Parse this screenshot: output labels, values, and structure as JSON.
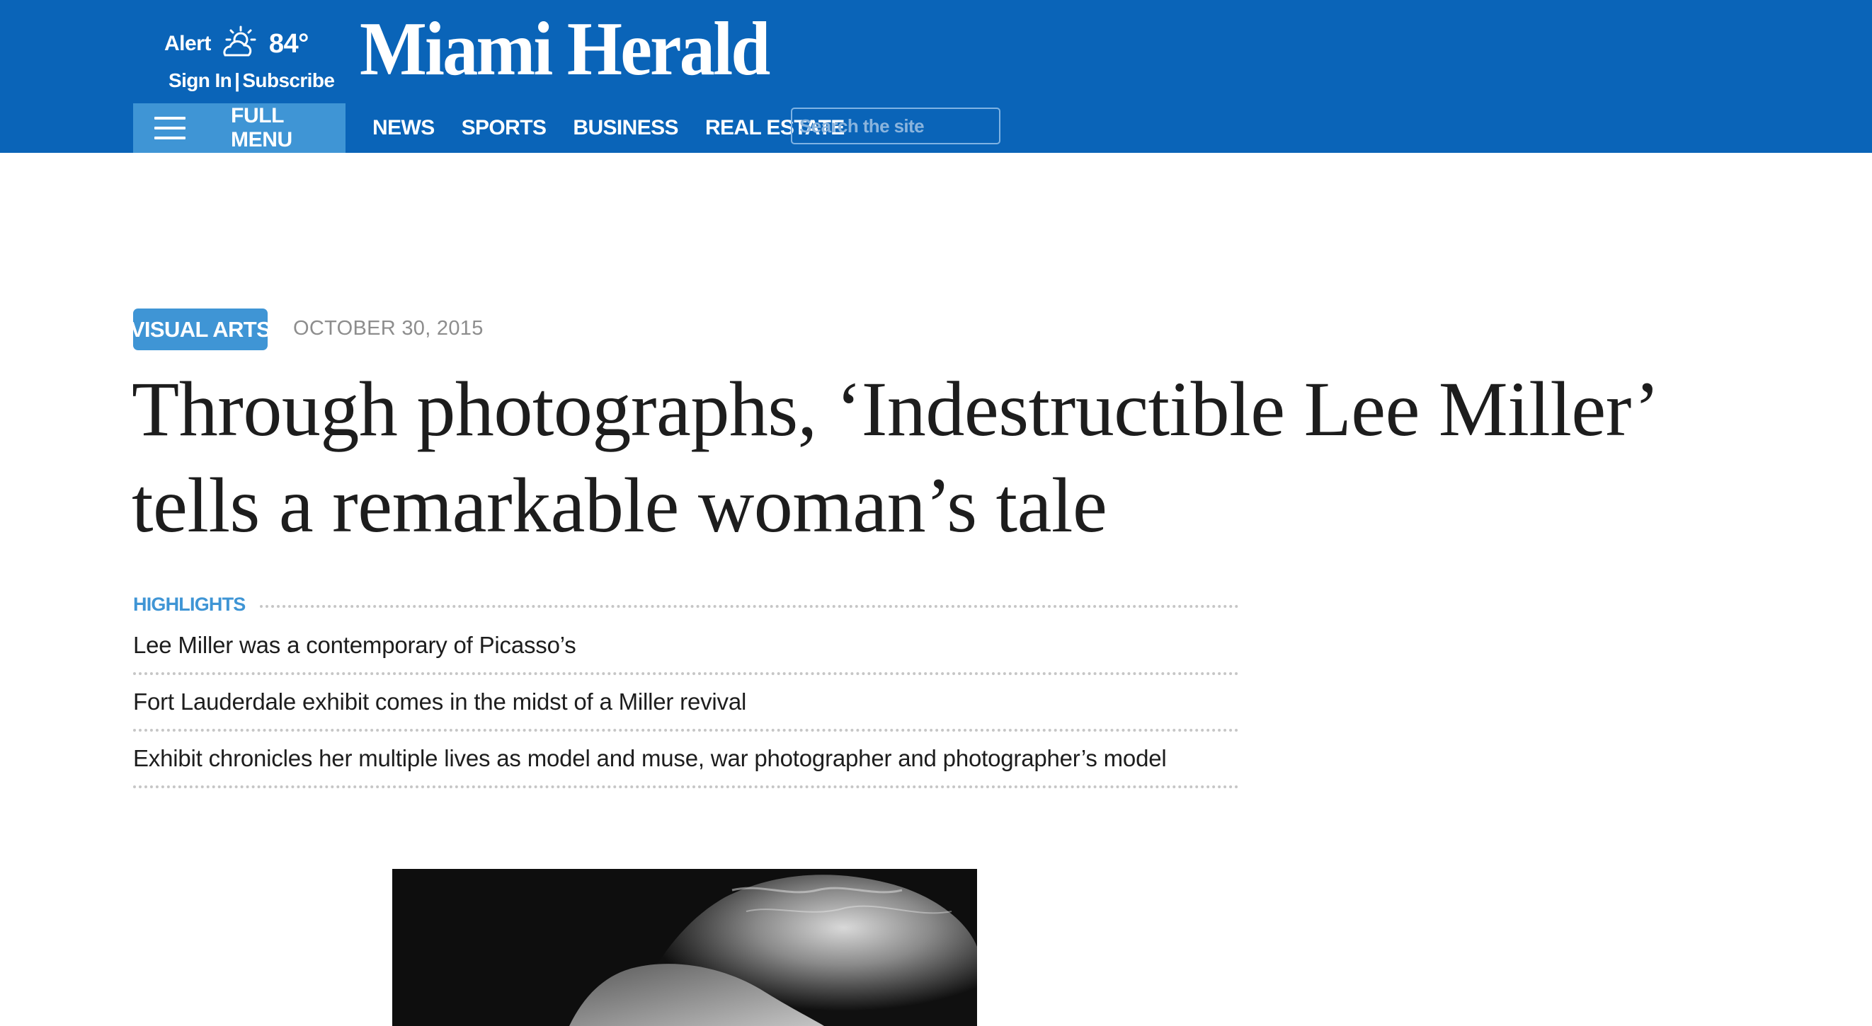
{
  "header": {
    "weather": {
      "alert_label": "Alert",
      "temperature": "84°",
      "icon": "partly-cloudy-icon"
    },
    "account": {
      "sign_in": "Sign In",
      "separator": "|",
      "subscribe": "Subscribe"
    },
    "logo_text": "Miami Herald",
    "menu_label": "FULL MENU",
    "nav": [
      "NEWS",
      "SPORTS",
      "BUSINESS",
      "REAL ESTATE"
    ],
    "search": {
      "placeholder": "Search the site",
      "value": ""
    }
  },
  "article": {
    "section_tag": "VISUAL ARTS",
    "date": "OCTOBER 30, 2015",
    "headline": "Through photographs, ‘Indestructible Lee Miller’ tells a remarkable woman’s tale",
    "highlights": {
      "title": "HIGHLIGHTS",
      "items": [
        "Lee Miller was a contemporary of Picasso’s",
        "Fort Lauderdale exhibit comes in the midst of a Miller revival",
        "Exhibit chronicles her multiple lives as model and muse, war photographer and photographer’s model"
      ]
    }
  },
  "colors": {
    "header_blue": "#0a64b8",
    "accent_blue": "#3f95d5",
    "headline_text": "#1d1d1d",
    "date_gray": "#8d8d8d"
  }
}
